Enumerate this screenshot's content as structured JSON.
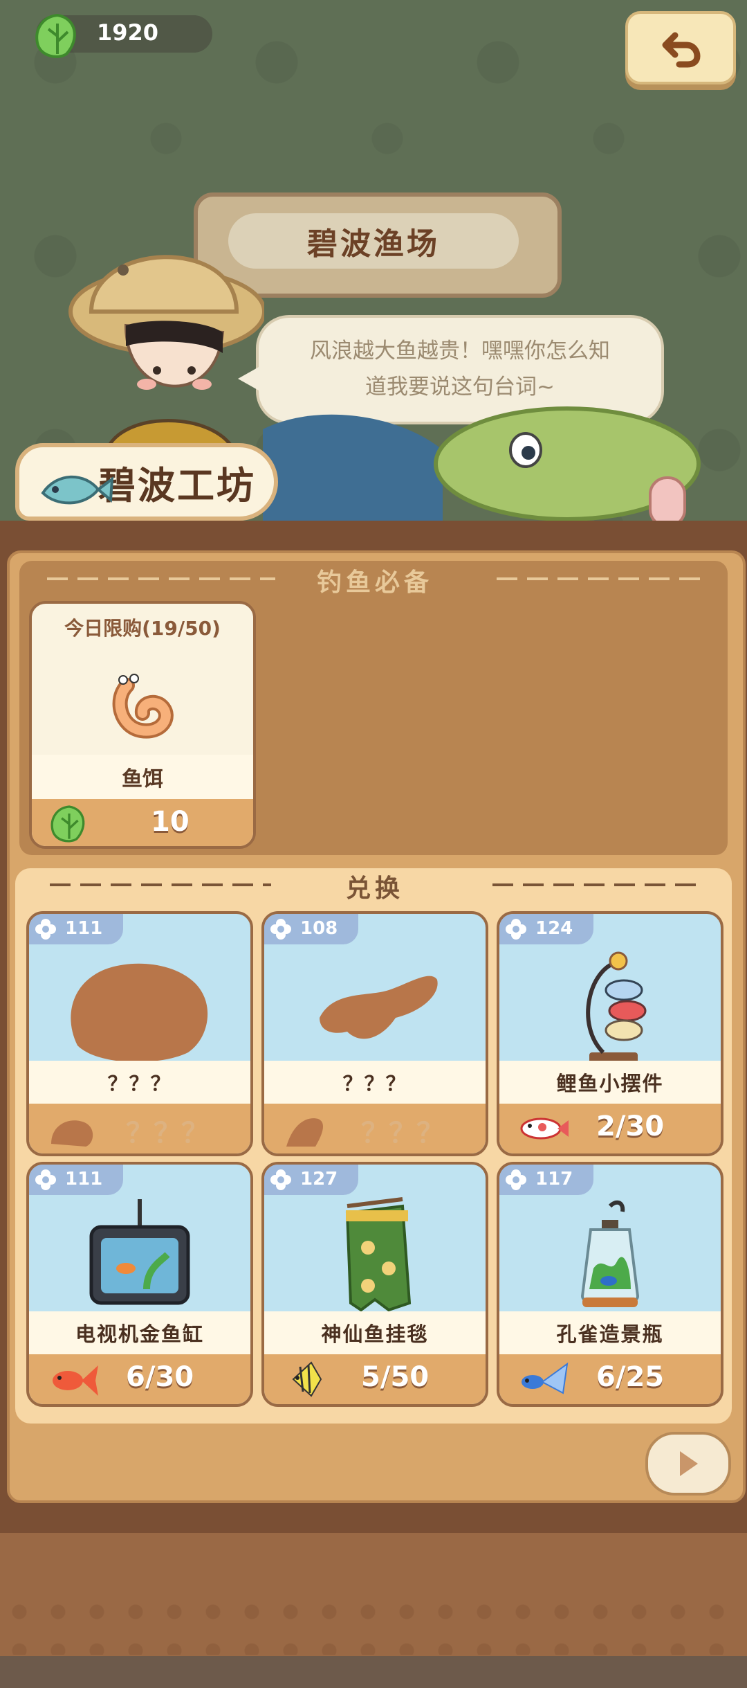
{
  "header": {
    "coin_amount": "1920",
    "coin_icon": "leaf-icon",
    "back_icon": "back-arrow-icon"
  },
  "scene": {
    "location_title": "碧波渔场",
    "npc_dialogue_line1": "风浪越大鱼越贵！嘿嘿你怎么知",
    "npc_dialogue_line2": "道我要说这句台词~",
    "shop_name": "碧波工坊"
  },
  "essentials": {
    "section_title": "钓鱼必备",
    "item": {
      "limit_label": "今日限购(19/50)",
      "name": "鱼饵",
      "price": "10",
      "currency_icon": "leaf-icon"
    }
  },
  "exchange": {
    "section_title": "兑换",
    "items": [
      {
        "badge": "111",
        "name": "？？？",
        "progress": "？？？",
        "locked": true,
        "fish_icon": "silhouette-icon"
      },
      {
        "badge": "108",
        "name": "？？？",
        "progress": "？？？",
        "locked": true,
        "fish_icon": "silhouette-icon"
      },
      {
        "badge": "124",
        "name": "鲤鱼小摆件",
        "progress": "2/30",
        "locked": false,
        "fish_icon": "koi-fish-icon"
      },
      {
        "badge": "111",
        "name": "电视机金鱼缸",
        "progress": "6/30",
        "locked": false,
        "fish_icon": "goldfish-icon"
      },
      {
        "badge": "127",
        "name": "神仙鱼挂毯",
        "progress": "5/50",
        "locked": false,
        "fish_icon": "angelfish-icon"
      },
      {
        "badge": "117",
        "name": "孔雀造景瓶",
        "progress": "6/25",
        "locked": false,
        "fish_icon": "guppy-icon"
      }
    ]
  },
  "colors": {
    "panel": "#d8a66a",
    "card_sky": "#bfe3f1",
    "price_bar": "#e1aa6b"
  }
}
